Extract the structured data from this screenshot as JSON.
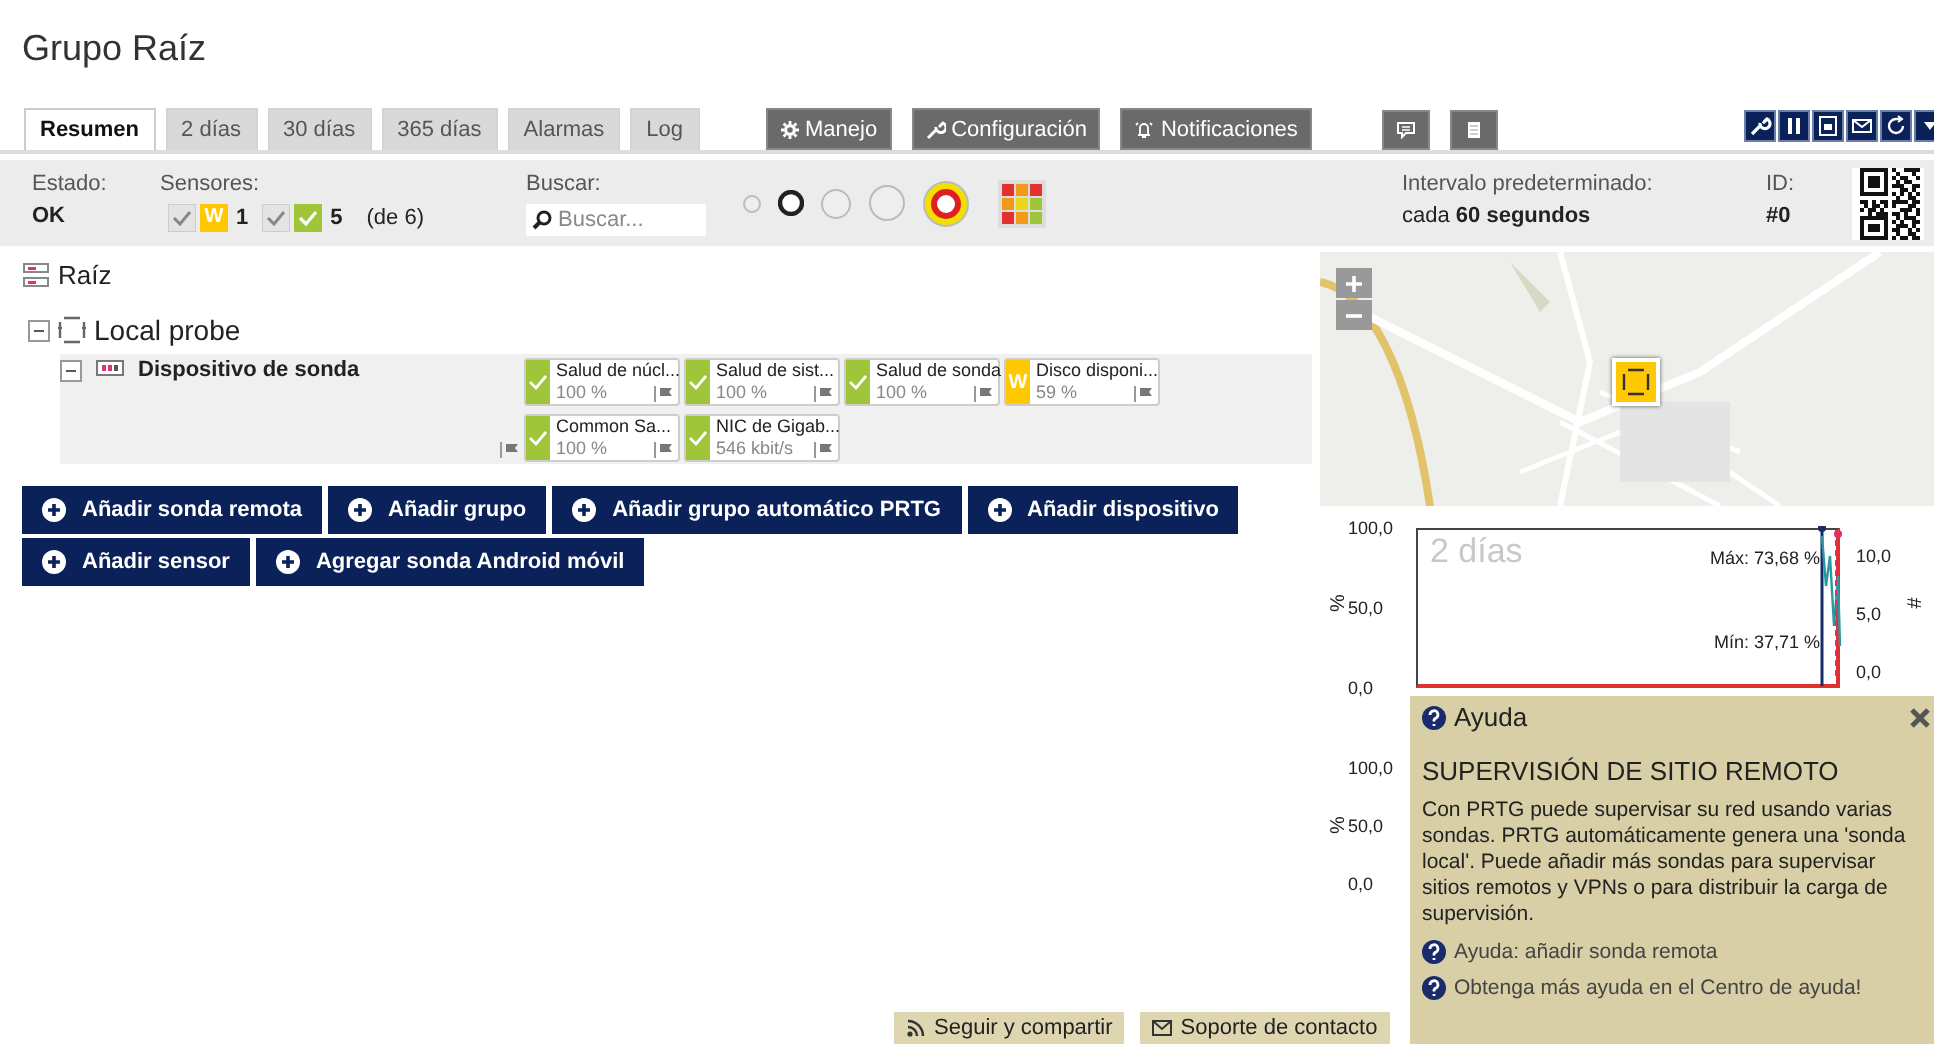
{
  "page_title": "Grupo Raíz",
  "tabs": [
    {
      "label": "Resumen",
      "selected": true
    },
    {
      "label": "2 días",
      "selected": false
    },
    {
      "label": "30 días",
      "selected": false
    },
    {
      "label": "365 días",
      "selected": false
    },
    {
      "label": "Alarmas",
      "selected": false
    },
    {
      "label": "Log",
      "selected": false
    }
  ],
  "menus": [
    {
      "label": "Manejo",
      "kind": "gear"
    },
    {
      "label": "Configuración",
      "kind": "wrench"
    },
    {
      "label": "Notificaciones",
      "kind": "bell"
    }
  ],
  "status": {
    "state_label": "Estado:",
    "state": "OK",
    "sensors_label": "Sensores:",
    "warning_mark": "W",
    "warning_count": "1",
    "ok_count": "5",
    "total": "(de 6)",
    "search_label": "Buscar:",
    "search_placeholder": "Buscar...",
    "interval_label": "Intervalo predeterminado:",
    "interval": "cada **60 segundos**",
    "id_label": "ID:",
    "id": "#0"
  },
  "view_sizes": [
    {
      "selected": false
    },
    {
      "selected": true
    },
    {
      "selected": false
    },
    {
      "selected": false
    }
  ],
  "tree": {
    "label": "Raíz",
    "children": [
      {
        "label": "Local probe",
        "expanded": true,
        "children": [
          {
            "label": "Dispositivo de sonda",
            "expanded": true,
            "sensors": [
              {
                "kind": "ok",
                "name": "Salud de núcl...",
                "value": "100 %"
              },
              {
                "kind": "ok",
                "name": "Salud de sist...",
                "value": "100 %"
              },
              {
                "kind": "ok",
                "name": "Salud de sonda",
                "value": "100 %"
              },
              {
                "kind": "warning",
                "mark": "W",
                "name": "Disco disponi...",
                "value": "59 %"
              },
              {
                "kind": "ok",
                "name": "Common Sa...",
                "value": "100 %"
              },
              {
                "kind": "ok",
                "name": "NIC de Gigab...",
                "value": "546 kbit/s"
              }
            ]
          }
        ]
      }
    ]
  },
  "actions": [
    "Añadir sonda remota",
    "Añadir grupo",
    "Añadir grupo automático PRTG",
    "Añadir dispositivo",
    "Añadir sensor",
    "Agregar sonda Android móvil"
  ],
  "graph_1": {
    "period": "2 días",
    "max": "Máx: 73,68 %",
    "min": "Mín: 37,71 %",
    "left_unit": "%",
    "left_ticks": [
      "100,0",
      "50,0",
      "0,0"
    ],
    "right_unit": "#",
    "right_ticks": [
      "10,0",
      "5,0",
      "0,0"
    ]
  },
  "graph_2": {
    "left_unit": "%",
    "left_ticks": [
      "100,0",
      "50,0",
      "0,0"
    ]
  },
  "help": {
    "title": "Ayuda",
    "heading": "SUPERVISIÓN DE SITIO REMOTO",
    "text": "Con PRTG puede supervisar su red usando varias sondas. PRTG automáticamente genera una 'sonda local'. Puede añadir más sondas para supervisar sitios remotos y VPNs o para distribuir la carga de supervisión.",
    "links": [
      "Ayuda: añadir sonda remota",
      "Obtenga más ayuda en el Centro de ayuda!"
    ]
  },
  "footer": [
    {
      "label": "Seguir y compartir",
      "kind": "rss"
    },
    {
      "label": "Soporte de contacto",
      "kind": "mail"
    }
  ]
}
